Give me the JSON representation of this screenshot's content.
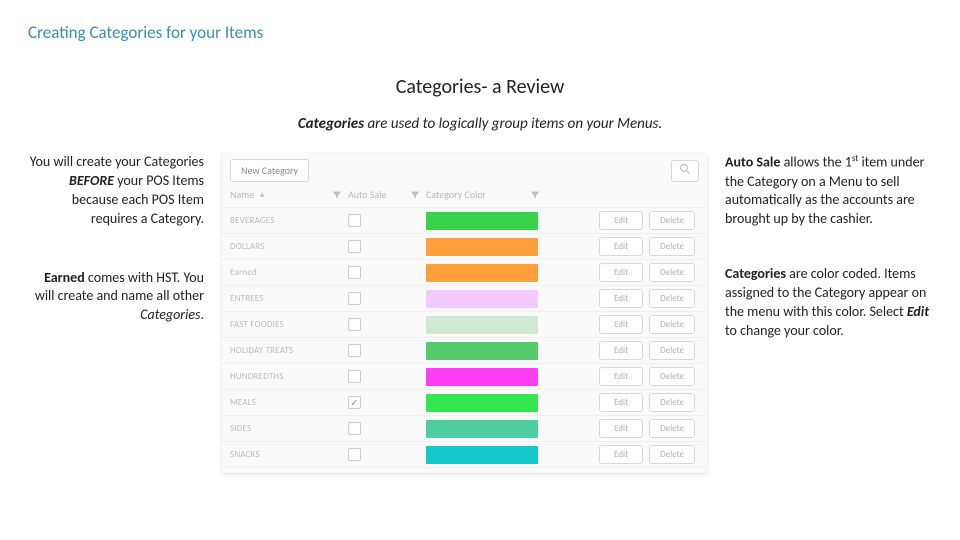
{
  "page_title": "Creating Categories for your Items",
  "section_title": "Categories- a Review",
  "intro_italic": "Categories",
  "intro_rest": " are used to logically group items on your Menus.",
  "left": {
    "p1_a": "You will create your Categories ",
    "p1_b": "BEFORE",
    "p1_c": " your POS Items because each POS Item requires a Category.",
    "p2_a": "Earned",
    "p2_b": " comes with HST. You will create and name all other ",
    "p2_c": "Categories",
    "p2_d": "."
  },
  "right": {
    "p1_a": "Auto Sale",
    "p1_b": " allows the 1",
    "p1_sup": "st",
    "p1_c": " item under the Category on a Menu to sell automatically as the accounts are brought up by the cashier.",
    "p2_a": "Categories",
    "p2_b": " are color coded. Items assigned to the Category appear on the menu with this color. Select ",
    "p2_c": "Edit",
    "p2_d": " to change your color."
  },
  "app": {
    "new_category": "New Category",
    "head_name": "Name",
    "head_auto": "Auto Sale",
    "head_color": "Category Color",
    "edit": "Edit",
    "delete": "Delete",
    "rows": [
      {
        "name": "BEVERAGES",
        "auto": false,
        "color": "#35d24a"
      },
      {
        "name": "DOLLARS",
        "auto": false,
        "color": "#ff9f3b"
      },
      {
        "name": "Earned",
        "auto": false,
        "color": "#ff9f3b"
      },
      {
        "name": "ENTREES",
        "auto": false,
        "color": "#f3c9ff"
      },
      {
        "name": "FAST FOODIES",
        "auto": false,
        "color": "#cfe9d2"
      },
      {
        "name": "HOLIDAY TREATS",
        "auto": false,
        "color": "#52cc6a"
      },
      {
        "name": "HUNDREDTHS",
        "auto": false,
        "color": "#ff3df2"
      },
      {
        "name": "MEALS",
        "auto": true,
        "color": "#33e64d"
      },
      {
        "name": "SIDES",
        "auto": false,
        "color": "#4ecda0"
      },
      {
        "name": "SNACKS",
        "auto": false,
        "color": "#13c9c9"
      }
    ]
  }
}
